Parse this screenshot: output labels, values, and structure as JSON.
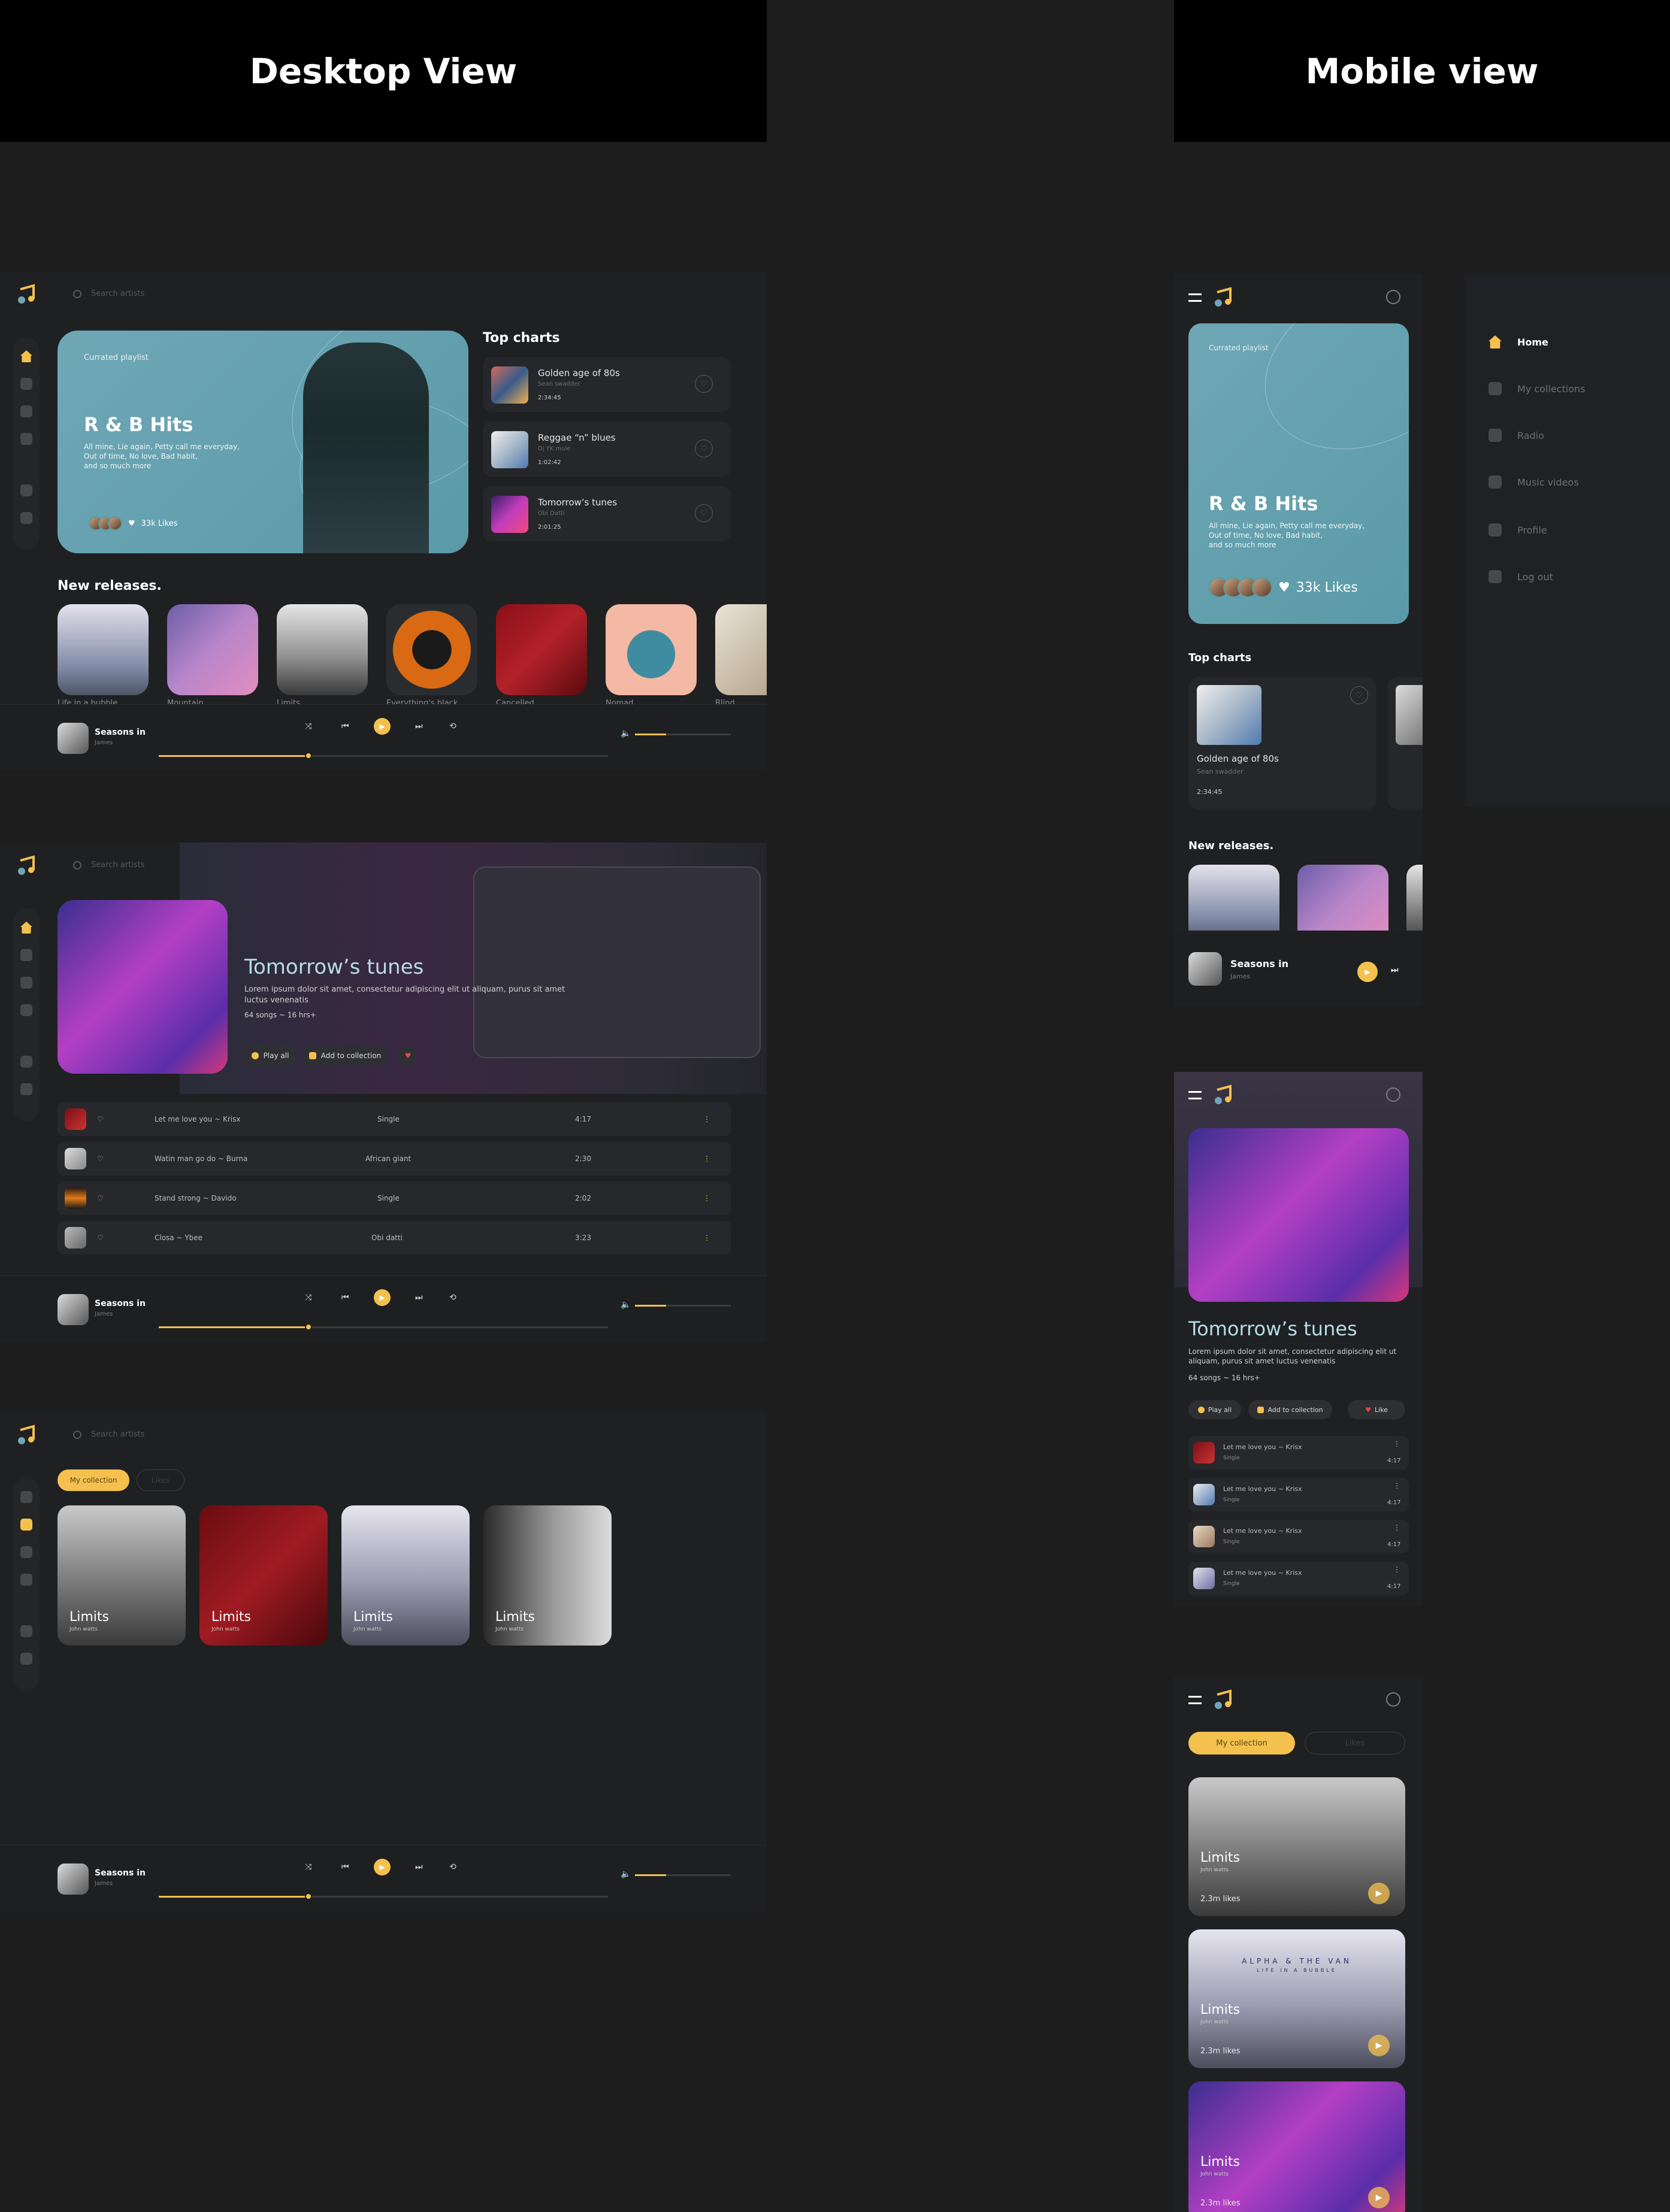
{
  "headers": {
    "desktop": "Desktop View",
    "mobile": "Mobile view"
  },
  "search": {
    "placeholder": "Search artists"
  },
  "hero": {
    "label": "Currated playlist",
    "title": "R & B Hits",
    "desc1": "All mine, Lie again, Petty call me everyday,",
    "desc2": "Out of time, No love, Bad habit,",
    "desc3": "and so much more",
    "likes": "33k Likes"
  },
  "top_charts": {
    "title": "Top charts",
    "items": [
      {
        "title": "Golden age of 80s",
        "artist": "Sean swadder",
        "duration": "2:34:45"
      },
      {
        "title": "Reggae “n” blues",
        "artist": "Dj YK mule",
        "duration": "1:02:42"
      },
      {
        "title": "Tomorrow’s tunes",
        "artist": "Obi Datti",
        "duration": "2:01:25"
      }
    ]
  },
  "new_releases": {
    "title": "New releases.",
    "items": [
      "Life in a bubble",
      "Mountain",
      "Limits",
      "Everything's black",
      "Cancelled",
      "Nomad",
      "Blind"
    ]
  },
  "player": {
    "song": "Seasons in",
    "artist": "James"
  },
  "album": {
    "title": "Tomorrow’s tunes",
    "desc": "Lorem ipsum dolor sit amet, consectetur adipiscing elit ut aliquam, purus sit amet luctus venenatis",
    "meta": "64 songs ~ 16 hrs+",
    "play_all": "Play all",
    "add": "Add to collection",
    "like": "Like",
    "tracks": [
      {
        "name": "Let me love you ~ Krisx",
        "album": "Single",
        "time": "4:17"
      },
      {
        "name": "Watin man go do ~ Burna",
        "album": "African giant",
        "time": "2:30"
      },
      {
        "name": "Stand strong ~ Davido",
        "album": "Single",
        "time": "2:02"
      },
      {
        "name": "Closa ~ Ybee",
        "album": "Obi datti",
        "time": "3:23"
      }
    ],
    "mobile_tracks": [
      {
        "name": "Let me love you ~ Krisx",
        "album": "Single",
        "time": "4:17"
      },
      {
        "name": "Let me love you ~ Krisx",
        "album": "Single",
        "time": "4:17"
      },
      {
        "name": "Let me love you ~ Krisx",
        "album": "Single",
        "time": "4:17"
      },
      {
        "name": "Let me love you ~ Krisx",
        "album": "Single",
        "time": "4:17"
      }
    ]
  },
  "collection": {
    "tab_active": "My collection",
    "tab_other": "Likes",
    "items": [
      {
        "title": "Limits",
        "artist": "John watts",
        "likes": "2.3m likes"
      },
      {
        "title": "Limits",
        "artist": "John watts",
        "likes": "2.3m likes"
      },
      {
        "title": "Limits",
        "artist": "John watts",
        "likes": "2.3m likes"
      },
      {
        "title": "Limits",
        "artist": "John watts",
        "likes": "2.3m likes"
      }
    ],
    "album_art_text": "ALPHA & THE VAN",
    "album_art_sub": "LIFE IN A BUBBLE"
  },
  "menu": {
    "items": [
      "Home",
      "My collections",
      "Radio",
      "Music videos",
      "Profile",
      "Log out"
    ]
  },
  "colors": {
    "accent": "#f4c14f",
    "hero": "#6fa7b5",
    "bg": "#1f2022"
  }
}
